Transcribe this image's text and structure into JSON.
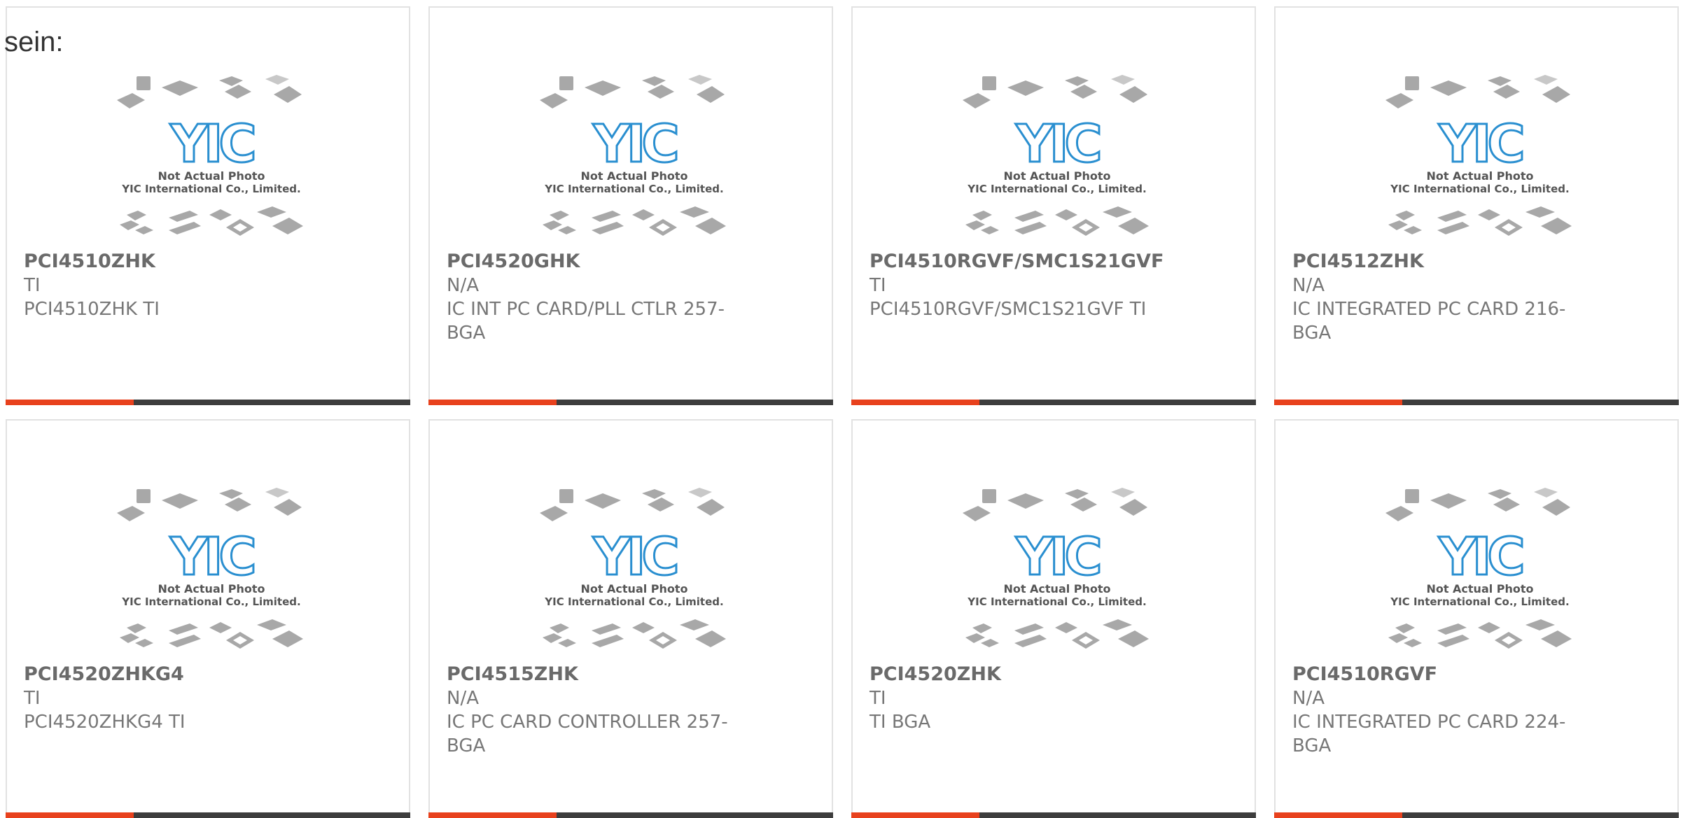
{
  "header": {
    "label": "sein:"
  },
  "colors": {
    "accent": "#e8411d",
    "bar": "#3d3d3d",
    "logo_blue": "#2a8fd0",
    "chip_gray": "#a8a8a8"
  },
  "placeholder_image": {
    "logo_text": "YIC",
    "caption_line1": "Not Actual Photo",
    "caption_line2": "YIC International Co., Limited."
  },
  "products": [
    {
      "part": "PCI4510ZHK",
      "maker": "TI",
      "desc": "PCI4510ZHK TI"
    },
    {
      "part": "PCI4520GHK",
      "maker": "N/A",
      "desc": "IC INT PC CARD/PLL CTLR 257-BGA"
    },
    {
      "part": "PCI4510RGVF/SMC1S21GVF",
      "maker": "TI",
      "desc": "PCI4510RGVF/SMC1S21GVF TI"
    },
    {
      "part": "PCI4512ZHK",
      "maker": "N/A",
      "desc": "IC INTEGRATED PC CARD 216-BGA"
    },
    {
      "part": "PCI4520ZHKG4",
      "maker": "TI",
      "desc": "PCI4520ZHKG4 TI"
    },
    {
      "part": "PCI4515ZHK",
      "maker": "N/A",
      "desc": "IC PC CARD CONTROLLER 257-BGA"
    },
    {
      "part": "PCI4520ZHK",
      "maker": "TI",
      "desc": "TI BGA"
    },
    {
      "part": "PCI4510RGVF",
      "maker": "N/A",
      "desc": "IC INTEGRATED PC CARD 224-BGA"
    }
  ]
}
